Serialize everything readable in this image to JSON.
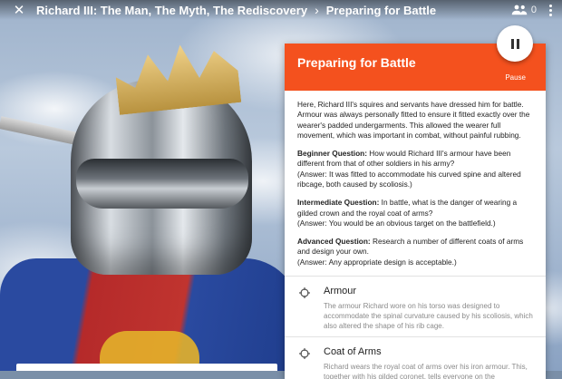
{
  "topbar": {
    "close_icon": "close-icon",
    "tour_title": "Richard III: The Man, The Myth, The Rediscovery",
    "separator_icon": "chevron-right-icon",
    "current_scene": "Preparing for Battle",
    "people_icon": "people-icon",
    "viewer_count": "0",
    "more_icon": "more-vert-icon"
  },
  "panel": {
    "title": "Preparing for Battle",
    "pause_label": "Pause",
    "accent_color": "#f4511e",
    "intro": "Here, Richard III's squires and servants have dressed him for battle. Armour was always personally fitted to ensure it fitted exactly over the wearer's padded undergarments. This allowed the wearer full movement, which was important in combat, without painful rubbing.",
    "questions": [
      {
        "label": "Beginner Question:",
        "text": " How would Richard III's armour have been different from that of other soldiers in his army?",
        "answer": "(Answer: It was fitted to accommodate his curved spine and altered ribcage, both caused by scoliosis.)"
      },
      {
        "label": "Intermediate Question:",
        "text": " In battle, what is the danger of wearing a gilded crown and the royal coat of arms?",
        "answer": "(Answer: You would be an obvious target on the battlefield.)"
      },
      {
        "label": "Advanced Question:",
        "text": " Research a number of different coats of arms and design your own.",
        "answer": "(Answer: Any appropriate design is acceptable.)"
      }
    ],
    "points_of_interest": [
      {
        "icon": "target-icon",
        "title": "Armour",
        "description": "The armour Richard wore on his torso was designed to accommodate the spinal curvature caused by his scoliosis, which also altered the shape of his rib cage."
      },
      {
        "icon": "target-icon",
        "title": "Coat of Arms",
        "description": "Richard wears the royal coat of arms over his iron armour. This, together with his gilded coronet, tells everyone on the"
      }
    ]
  }
}
